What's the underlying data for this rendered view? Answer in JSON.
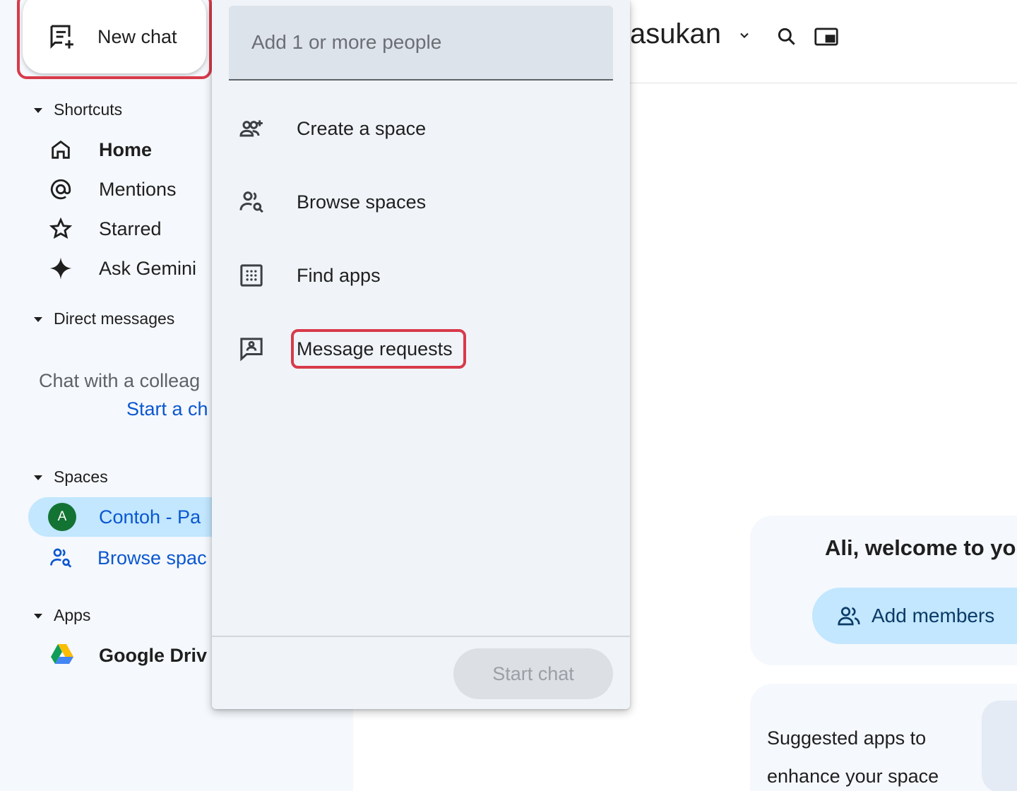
{
  "sidebar": {
    "new_chat_label": "New chat",
    "shortcuts_label": "Shortcuts",
    "shortcuts": [
      {
        "label": "Home",
        "icon": "home-icon"
      },
      {
        "label": "Mentions",
        "icon": "at-icon"
      },
      {
        "label": "Starred",
        "icon": "star-icon"
      },
      {
        "label": "Ask Gemini",
        "icon": "gemini-sparkle-icon"
      }
    ],
    "direct_messages_label": "Direct messages",
    "dm_empty_text": "Chat with a colleag",
    "dm_start_link": "Start a ch",
    "spaces_label": "Spaces",
    "space_avatar_letter": "A",
    "space_name": "Contoh - Pa",
    "browse_spaces_link": "Browse spac",
    "apps_label": "Apps",
    "app_name": "Google Driv"
  },
  "main": {
    "title": "asukan",
    "welcome_text": "Ali, welcome to yo",
    "add_members_label": "Add members",
    "suggested_text": "Suggested apps to enhance your space"
  },
  "menu": {
    "people_placeholder": "Add 1 or more people",
    "items": [
      {
        "label": "Create a space",
        "icon": "group-add-icon"
      },
      {
        "label": "Browse spaces",
        "icon": "group-search-icon"
      },
      {
        "label": "Find apps",
        "icon": "apps-grid-icon"
      },
      {
        "label": "Message requests",
        "icon": "message-request-icon"
      }
    ],
    "start_chat_label": "Start chat"
  },
  "colors": {
    "highlight": "#d83a4a",
    "accent_blue": "#0b57d0",
    "selected_bg": "#c2e7ff",
    "avatar_green": "#137333"
  }
}
